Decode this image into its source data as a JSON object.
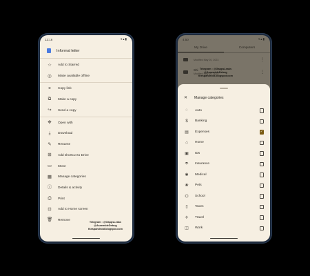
{
  "left": {
    "status_time": "12:16",
    "status_icons": "▾▴▮",
    "file_title": "Informal letter",
    "menu_groups": [
      [
        {
          "icon": "☆",
          "icon_name": "star-icon",
          "label": "Add to Starred"
        },
        {
          "icon": "◎",
          "icon_name": "offline-icon",
          "label": "Make available offline"
        }
      ],
      [
        {
          "icon": "⚭",
          "icon_name": "link-icon",
          "label": "Copy link"
        },
        {
          "icon": "⧉",
          "icon_name": "copy-icon",
          "label": "Make a copy"
        },
        {
          "icon": "↪",
          "icon_name": "send-icon",
          "label": "Send a copy"
        }
      ],
      [
        {
          "icon": "✥",
          "icon_name": "open-with-icon",
          "label": "Open with"
        },
        {
          "icon": "⤓",
          "icon_name": "download-icon",
          "label": "Download"
        },
        {
          "icon": "✎",
          "icon_name": "rename-icon",
          "label": "Rename"
        },
        {
          "icon": "⊞",
          "icon_name": "shortcut-icon",
          "label": "Add shortcut to Drive"
        },
        {
          "icon": "▭",
          "icon_name": "move-icon",
          "label": "Move"
        },
        {
          "icon": "▦",
          "icon_name": "categories-icon",
          "label": "Manage categories"
        },
        {
          "icon": "ⓘ",
          "icon_name": "info-icon",
          "label": "Details & activity"
        },
        {
          "icon": "⎙",
          "icon_name": "print-icon",
          "label": "Print"
        },
        {
          "icon": "⊡",
          "icon_name": "home-screen-icon",
          "label": "Add to Home screen"
        },
        {
          "icon": "🗑",
          "icon_name": "trash-icon",
          "label": "Remove"
        }
      ]
    ],
    "watermark": [
      "Telegram : @GappsLeaks",
      "@AssembleDebug",
      "thespandroid.blogspot.com"
    ]
  },
  "right": {
    "status_time": "4:50",
    "status_icons": "▾▴▮",
    "tabs": [
      "My Drive",
      "Computers"
    ],
    "files": [
      {
        "name": "",
        "modified": "Modified May 20, 2023"
      },
      {
        "name": "Shi",
        "modified": "Modified May 20, 2023"
      }
    ],
    "watermark": [
      "Telegram : @GappsLeaks",
      "@AssembleDebug",
      "thespandroid.blogspot.com"
    ],
    "sheet_title": "Manage categories",
    "categories": [
      {
        "icon": "◌",
        "icon_name": "auto-icon",
        "label": "Auto",
        "checked": false
      },
      {
        "icon": "$",
        "icon_name": "banking-icon",
        "label": "Banking",
        "checked": false
      },
      {
        "icon": "▤",
        "icon_name": "expenses-icon",
        "label": "Expenses",
        "checked": true
      },
      {
        "icon": "⌂",
        "icon_name": "home-icon",
        "label": "Home",
        "checked": false
      },
      {
        "icon": "▣",
        "icon_name": "ids-icon",
        "label": "IDs",
        "checked": false
      },
      {
        "icon": "☂",
        "icon_name": "insurance-icon",
        "label": "Insurance",
        "checked": false
      },
      {
        "icon": "✱",
        "icon_name": "medical-icon",
        "label": "Medical",
        "checked": false
      },
      {
        "icon": "❀",
        "icon_name": "pets-icon",
        "label": "Pets",
        "checked": false
      },
      {
        "icon": "⌬",
        "icon_name": "school-icon",
        "label": "School",
        "checked": false
      },
      {
        "icon": "▯",
        "icon_name": "taxes-icon",
        "label": "Taxes",
        "checked": false
      },
      {
        "icon": "✈",
        "icon_name": "travel-icon",
        "label": "Travel",
        "checked": false
      },
      {
        "icon": "◫",
        "icon_name": "work-icon",
        "label": "Work",
        "checked": false
      }
    ],
    "check_glyph": "✓"
  }
}
